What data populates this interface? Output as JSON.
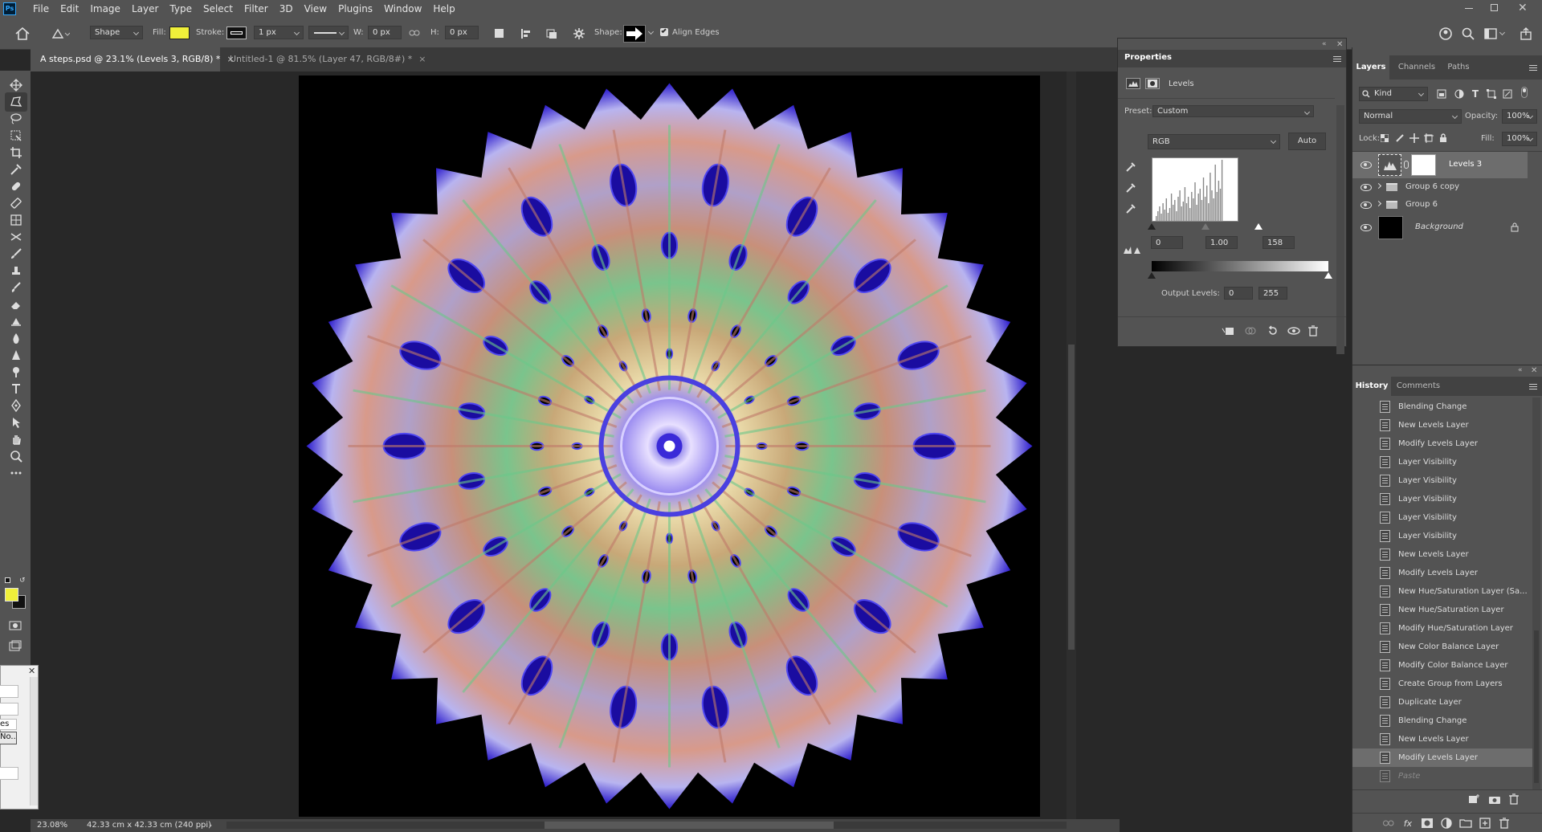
{
  "menu": {
    "items": [
      "File",
      "Edit",
      "Image",
      "Layer",
      "Type",
      "Select",
      "Filter",
      "3D",
      "View",
      "Plugins",
      "Window",
      "Help"
    ]
  },
  "options": {
    "mode": "Shape",
    "fill_label": "Fill:",
    "fill_color": "#f0f03a",
    "stroke_label": "Stroke:",
    "stroke_width": "1 px",
    "w_label": "W:",
    "w_value": "0 px",
    "h_label": "H:",
    "h_value": "0 px",
    "shape_label": "Shape:",
    "align_edges": "Align Edges"
  },
  "doc_tabs": [
    {
      "label": "A steps.psd @ 23.1% (Levels 3, RGB/8) *"
    },
    {
      "label": "Untitled-1 @ 81.5% (Layer 47, RGB/8#) *"
    }
  ],
  "tools": [
    "move-tool-icon",
    "polygon-select-icon",
    "lasso-icon",
    "object-select-icon",
    "crop-icon",
    "eyedropper-icon",
    "healing-brush-icon",
    "patch-icon",
    "frame-icon",
    "content-aware-move-icon",
    "brush-icon",
    "stamp-icon",
    "history-brush-icon",
    "eraser-icon",
    "gradient-icon",
    "blur-icon",
    "sharpen-icon",
    "dodge-icon",
    "text-icon",
    "pen-icon",
    "path-select-icon",
    "hand-icon",
    "zoom-icon",
    "more-tools-icon"
  ],
  "colors": {
    "foreground": "#f0f03a",
    "background": "#111111"
  },
  "properties": {
    "title": "Properties",
    "adjustment": "Levels",
    "preset_label": "Preset:",
    "preset_value": "Custom",
    "channel": "RGB",
    "auto_label": "Auto",
    "input_black": "0",
    "input_gamma": "1.00",
    "input_white": "158",
    "output_label": "Output Levels:",
    "output_black": "0",
    "output_white": "255"
  },
  "layers_panel": {
    "tabs": [
      "Layers",
      "Channels",
      "Paths"
    ],
    "kind_label": "Kind",
    "blend_mode": "Normal",
    "opacity_label": "Opacity:",
    "opacity_value": "100%",
    "lock_label": "Lock:",
    "fill_label": "Fill:",
    "fill_value": "100%",
    "layers": [
      {
        "name": "Levels 3",
        "type": "adjustment",
        "selected": true
      },
      {
        "name": "Group 6 copy",
        "type": "group"
      },
      {
        "name": "Group 6",
        "type": "group"
      },
      {
        "name": "Background",
        "type": "background",
        "locked": true
      }
    ]
  },
  "history_panel": {
    "tabs": [
      "History",
      "Comments"
    ],
    "items": [
      "Blending Change",
      "New Levels Layer",
      "Modify Levels Layer",
      "Layer Visibility",
      "Layer Visibility",
      "Layer Visibility",
      "Layer Visibility",
      "Layer Visibility",
      "New Levels Layer",
      "Modify Levels Layer",
      "New Hue/Saturation Layer (Sa...",
      "New Hue/Saturation Layer",
      "Modify Hue/Saturation Layer",
      "New Color Balance Layer",
      "Modify Color Balance Layer",
      "Create Group from Layers",
      "Duplicate Layer",
      "Blending Change",
      "New Levels Layer",
      "Modify Levels Layer",
      "Paste"
    ]
  },
  "status": {
    "zoom": "23.08%",
    "doc_size": "42.33 cm x 42.33 cm (240 ppi)"
  },
  "left_dialog": {
    "lines": [
      "es",
      "No..."
    ]
  }
}
